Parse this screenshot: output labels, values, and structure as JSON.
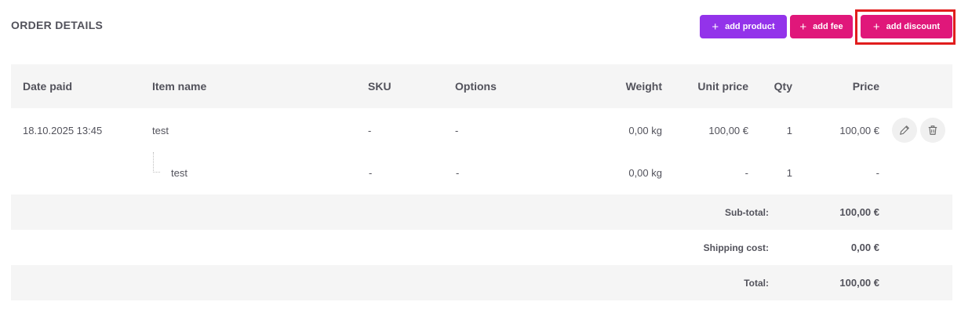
{
  "page": {
    "title": "ORDER DETAILS"
  },
  "toolbar": {
    "add_product": "add product",
    "add_fee": "add fee",
    "add_discount": "add discount",
    "plus": "+"
  },
  "table": {
    "headers": {
      "date_paid": "Date paid",
      "item_name": "Item name",
      "sku": "SKU",
      "options": "Options",
      "weight": "Weight",
      "unit_price": "Unit price",
      "qty": "Qty",
      "price": "Price"
    },
    "rows": [
      {
        "date_paid": "18.10.2025 13:45",
        "item_name": "test",
        "sku": "-",
        "options": "-",
        "weight": "0,00 kg",
        "unit_price": "100,00 €",
        "qty": "1",
        "price": "100,00 €"
      },
      {
        "date_paid": "",
        "item_name": "test",
        "sku": "-",
        "options": "-",
        "weight": "0,00 kg",
        "unit_price": "-",
        "qty": "1",
        "price": "-"
      }
    ]
  },
  "summary": {
    "subtotal_label": "Sub-total:",
    "subtotal_value": "100,00 €",
    "shipping_label": "Shipping cost:",
    "shipping_value": "0,00 €",
    "total_label": "Total:",
    "total_value": "100,00 €"
  },
  "colors": {
    "purple": "#9333ea",
    "pink": "#e0177a",
    "highlight": "#e11d1d"
  },
  "icons": {
    "row_edit": "pencil-icon",
    "row_delete": "trash-icon"
  }
}
